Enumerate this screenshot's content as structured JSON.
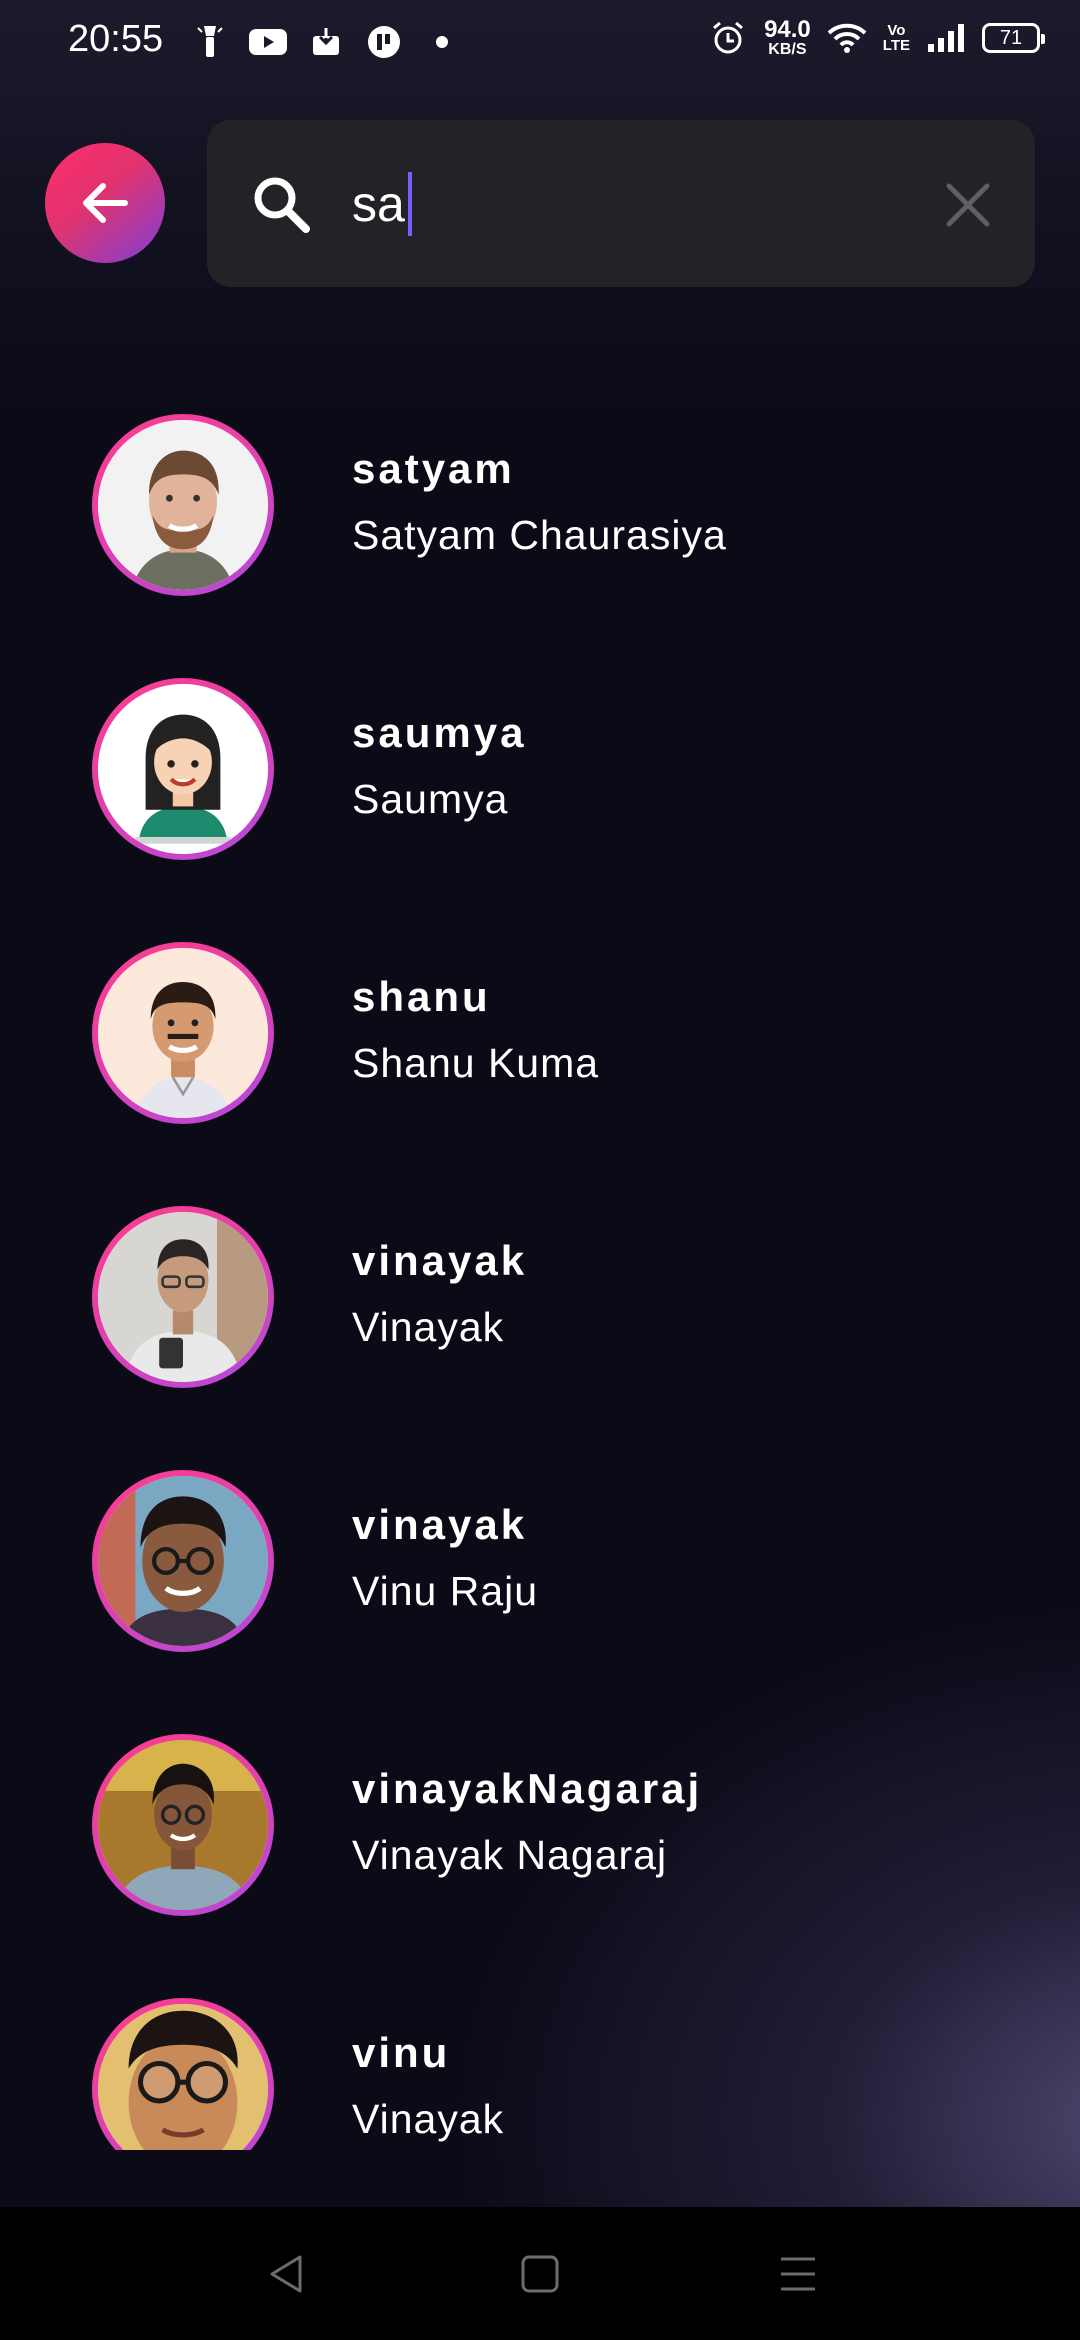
{
  "status_bar": {
    "time": "20:55",
    "net_speed_value": "94.0",
    "net_speed_unit": "KB/S",
    "volte_line1": "Vo",
    "volte_line2": "LTE",
    "battery": "71",
    "left_icons": [
      "torch-icon",
      "youtube-icon",
      "download-icon",
      "app-icon",
      "dot-icon"
    ],
    "right_icons": [
      "alarm-icon",
      "wifi-icon",
      "signal-icon"
    ]
  },
  "header": {
    "back_icon": "arrow-left-icon",
    "search": {
      "value": "sa",
      "search_icon": "search-icon",
      "clear_icon": "close-icon"
    }
  },
  "results": [
    {
      "username": "satyam",
      "full_name": "Satyam Chaurasiya"
    },
    {
      "username": "saumya",
      "full_name": "Saumya"
    },
    {
      "username": "shanu",
      "full_name": "Shanu Kuma"
    },
    {
      "username": "vinayak",
      "full_name": "Vinayak"
    },
    {
      "username": "vinayak",
      "full_name": "Vinu Raju"
    },
    {
      "username": "vinayakNagaraj",
      "full_name": "Vinayak Nagaraj"
    },
    {
      "username": "vinu",
      "full_name": "Vinayak"
    }
  ],
  "nav_bar": {
    "back": "triangle-back-icon",
    "home": "square-home-icon",
    "menu": "menu-lines-icon"
  },
  "colors": {
    "background": "#0b0a17",
    "search_bg": "#232226",
    "accent_pink": "#ff2d6b",
    "accent_purple": "#7c3fd8",
    "caret": "#7b5cff"
  }
}
